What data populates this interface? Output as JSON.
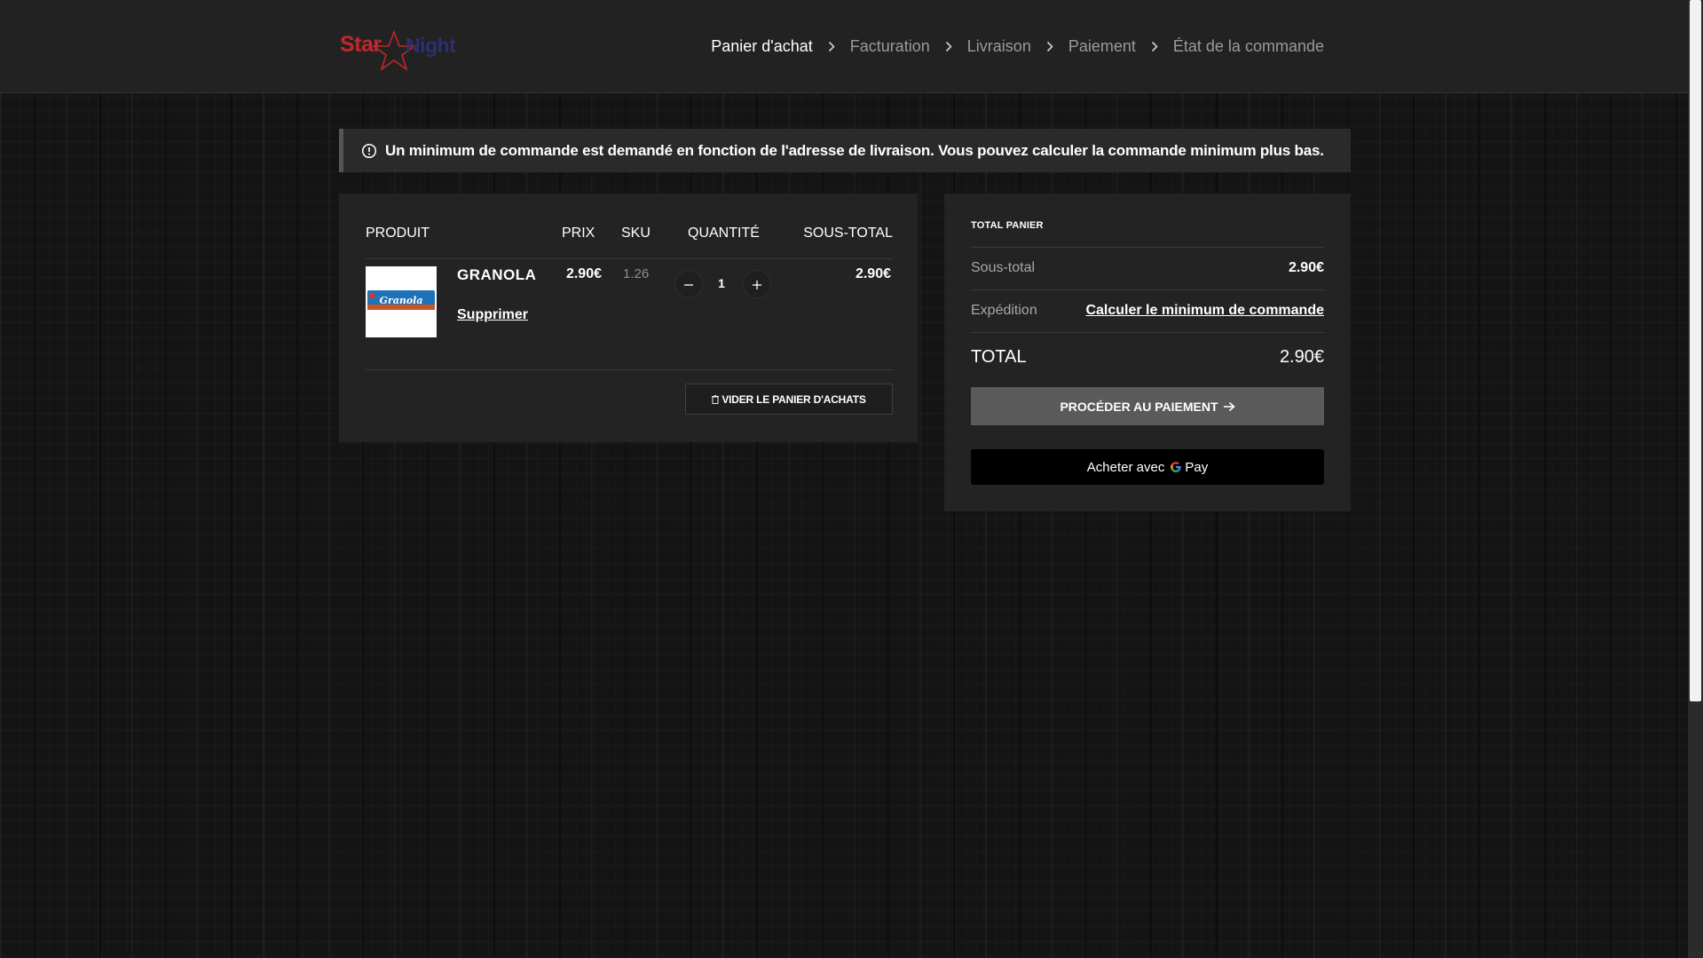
{
  "logo": {
    "star_word": "Star",
    "night_word": "Night"
  },
  "breadcrumb": [
    {
      "label": "Panier d'achat",
      "active": true
    },
    {
      "label": "Facturation",
      "active": false
    },
    {
      "label": "Livraison",
      "active": false
    },
    {
      "label": "Paiement",
      "active": false
    },
    {
      "label": "État de la commande",
      "active": false
    }
  ],
  "notice": {
    "icon": "info-icon",
    "text": "Un minimum de commande est demandé en fonction de l'adresse de livraison. Vous pouvez calculer la commande minimum plus bas."
  },
  "cart": {
    "headers": {
      "product": "PRODUIT",
      "price": "PRIX",
      "sku": "SKU",
      "quantity": "QUANTITÉ",
      "subtotal": "SOUS-TOTAL"
    },
    "items": [
      {
        "name": "GRANOLA",
        "image_label": "Granola",
        "remove_label": "Supprimer",
        "price": "2.90€",
        "sku": "1.26",
        "quantity": "1",
        "subtotal": "2.90€"
      }
    ],
    "empty_button": "VIDER LE PANIER D'ACHATS"
  },
  "totals": {
    "title": "TOTAL PANIER",
    "subtotal_label": "Sous-total",
    "subtotal_value": "2.90€",
    "shipping_label": "Expédition",
    "shipping_link": "Calculer le minimum de commande",
    "total_label": "TOTAL",
    "total_value": "2.90€",
    "checkout_button": "PROCÉDER AU PAIEMENT",
    "gpay_prefix": "Acheter avec",
    "gpay_suffix": "Pay"
  },
  "colors": {
    "header_bg": "#222222",
    "panel_bg": "#232323",
    "logo_red": "#c3262c",
    "logo_blue": "#2d2f6e",
    "checkout_bg": "#5a5a5a"
  }
}
